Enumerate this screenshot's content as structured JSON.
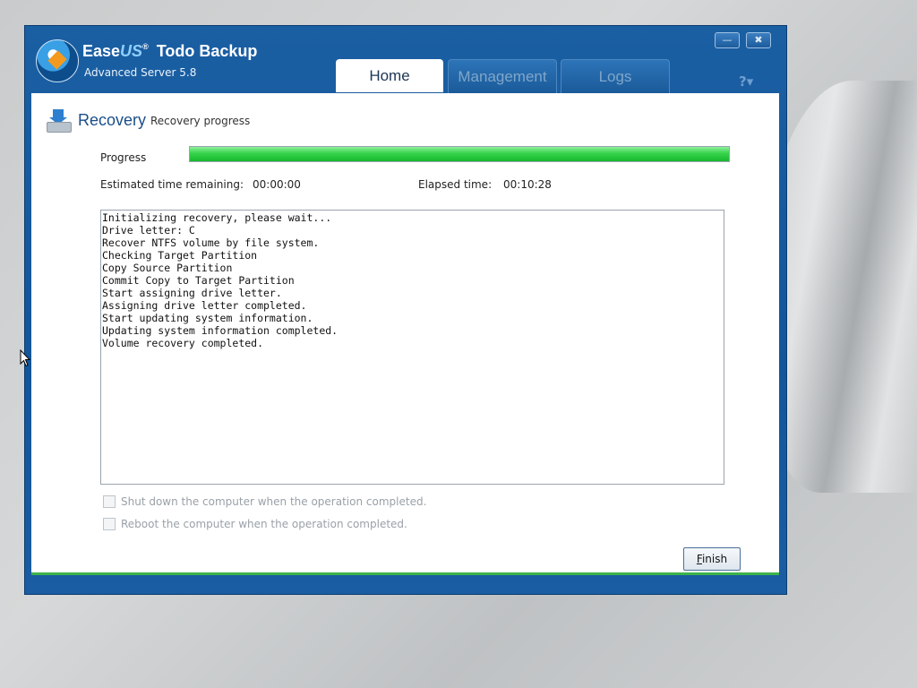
{
  "app": {
    "brand_ease": "Ease",
    "brand_us": "US",
    "brand_reg": "®",
    "brand_product": "Todo Backup",
    "edition": "Advanced Server 5.8"
  },
  "tabs": [
    {
      "label": "Home"
    },
    {
      "label": "Management"
    },
    {
      "label": "Logs"
    }
  ],
  "window_controls": {
    "minimize": "—",
    "close": "✖",
    "help": "?▾"
  },
  "recovery": {
    "title": "Recovery",
    "subtitle": "Recovery progress",
    "progress_label": "Progress",
    "progress_fraction": 1.0,
    "estimated_label": "Estimated time remaining:",
    "estimated_value": "00:00:00",
    "elapsed_label": "Elapsed time:",
    "elapsed_value": "00:10:28",
    "log_lines": [
      "Initializing recovery, please wait...",
      "Drive letter: C",
      "Recover NTFS volume by file system.",
      "Checking Target Partition",
      "Copy Source Partition",
      "Commit Copy to Target Partition",
      "Start assigning drive letter.",
      "Assigning drive letter completed.",
      "Start updating system information.",
      "Updating system information completed.",
      "Volume recovery completed."
    ],
    "shutdown_label": "Shut down the computer when the operation completed.",
    "reboot_label": "Reboot the computer when the operation completed.",
    "finish_mnemonic": "F",
    "finish_rest": "inish"
  },
  "colors": {
    "accent_green": "#17b92e",
    "window_blue": "#13559a"
  }
}
